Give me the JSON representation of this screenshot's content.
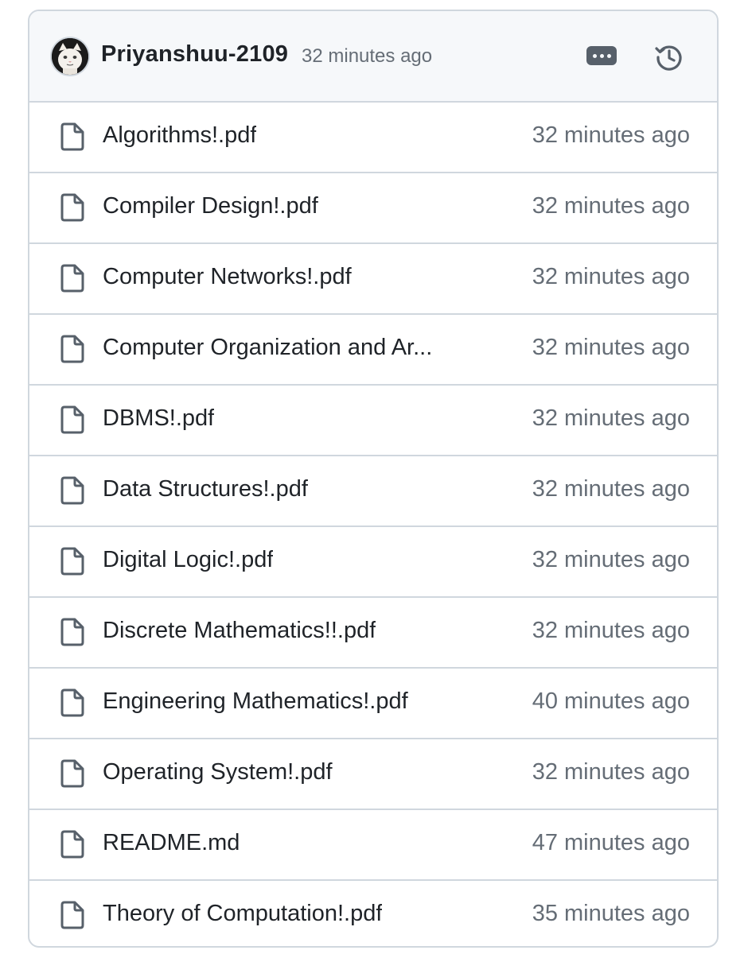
{
  "commit": {
    "author": "Priyanshuu-2109",
    "time": "32 minutes ago",
    "more_icon": "kebab-horizontal-icon",
    "history_icon": "history-icon"
  },
  "files": [
    {
      "name": "Algorithms!.pdf",
      "time": "32 minutes ago",
      "icon": "file-icon"
    },
    {
      "name": "Compiler Design!.pdf",
      "time": "32 minutes ago",
      "icon": "file-icon"
    },
    {
      "name": "Computer Networks!.pdf",
      "time": "32 minutes ago",
      "icon": "file-icon"
    },
    {
      "name": "Computer Organization and Ar...",
      "time": "32 minutes ago",
      "icon": "file-icon"
    },
    {
      "name": "DBMS!.pdf",
      "time": "32 minutes ago",
      "icon": "file-icon"
    },
    {
      "name": "Data Structures!.pdf",
      "time": "32 minutes ago",
      "icon": "file-icon"
    },
    {
      "name": "Digital Logic!.pdf",
      "time": "32 minutes ago",
      "icon": "file-icon"
    },
    {
      "name": "Discrete Mathematics!!.pdf",
      "time": "32 minutes ago",
      "icon": "file-icon"
    },
    {
      "name": "Engineering Mathematics!.pdf",
      "time": "40 minutes ago",
      "icon": "file-icon"
    },
    {
      "name": "Operating System!.pdf",
      "time": "32 minutes ago",
      "icon": "file-icon"
    },
    {
      "name": "README.md",
      "time": "47 minutes ago",
      "icon": "file-icon"
    },
    {
      "name": "Theory of Computation!.pdf",
      "time": "35 minutes ago",
      "icon": "file-icon"
    }
  ],
  "colors": {
    "border": "#d0d7de",
    "header_bg": "#f6f8fa",
    "text_primary": "#1f2328",
    "text_muted": "#656d76",
    "icon": "#57606a"
  }
}
